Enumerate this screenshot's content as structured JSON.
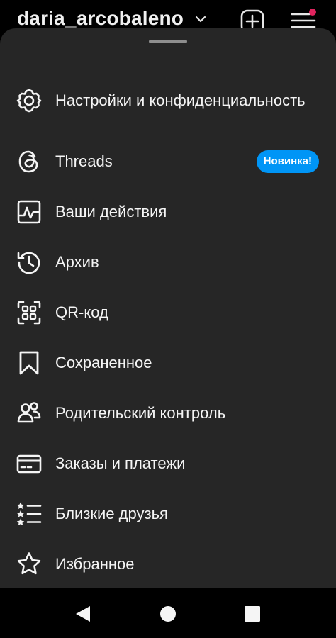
{
  "header": {
    "username": "daria_arcobaleno",
    "notification_dot_color": "#e0245e"
  },
  "sheet": {
    "items": [
      {
        "label": "Настройки и конфиденциальность",
        "icon": "gear-icon"
      },
      {
        "label": "Threads",
        "icon": "threads-icon",
        "badge": "Новинка!"
      },
      {
        "label": "Ваши действия",
        "icon": "activity-icon"
      },
      {
        "label": "Архив",
        "icon": "archive-icon"
      },
      {
        "label": "QR-код",
        "icon": "qr-code-icon"
      },
      {
        "label": "Сохраненное",
        "icon": "bookmark-icon"
      },
      {
        "label": "Родительский контроль",
        "icon": "supervision-icon"
      },
      {
        "label": "Заказы и платежи",
        "icon": "card-icon"
      },
      {
        "label": "Близкие друзья",
        "icon": "close-friends-icon"
      },
      {
        "label": "Избранное",
        "icon": "star-icon"
      }
    ]
  },
  "colors": {
    "sheet_background": "#262626",
    "badge_background": "#0095f6",
    "text": "#f5f5f5"
  }
}
